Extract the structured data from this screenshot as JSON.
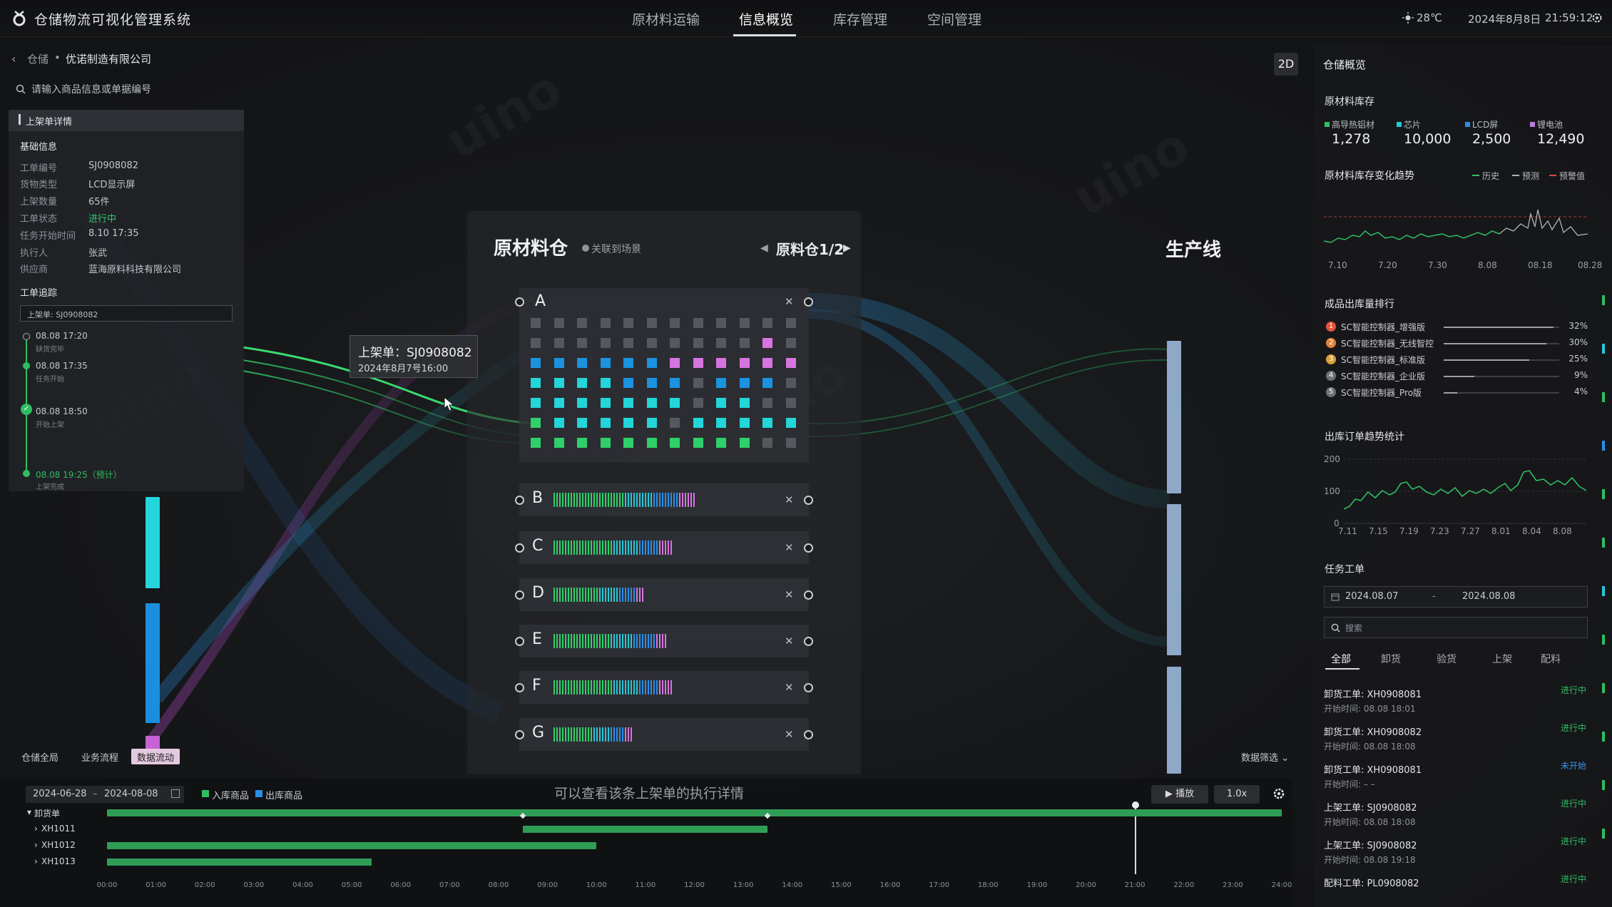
{
  "header": {
    "app_title": "仓储物流可视化管理系统",
    "tabs": [
      "原材料运输",
      "信息概览",
      "库存管理",
      "空间管理"
    ],
    "active_tab": "信息概览",
    "weather": "28℃",
    "date": "2024年8月8日",
    "time": "21:59:12"
  },
  "breadcrumb": {
    "parent": "仓储",
    "separator": "•",
    "current": "优诺制造有限公司"
  },
  "search": {
    "placeholder": "请输入商品信息或单据编号"
  },
  "detail": {
    "title": "上架单详情",
    "basic_title": "基础信息",
    "fields": [
      {
        "label": "工单编号",
        "value": "SJ0908082"
      },
      {
        "label": "货物类型",
        "value": "LCD显示屏"
      },
      {
        "label": "上架数量",
        "value": "65件"
      },
      {
        "label": "工单状态",
        "value": "进行中"
      },
      {
        "label": "任务开始时间",
        "value": "8.10 17:35"
      },
      {
        "label": "执行人",
        "value": "张武"
      },
      {
        "label": "供应商",
        "value": "蓝海原料科技有限公司"
      }
    ],
    "trace_title": "工单追踪",
    "trace_input": "上架单: SJ0908082",
    "trace": [
      {
        "time": "08.08 17:20",
        "note": "缺货完毕"
      },
      {
        "time": "08.08 17:35",
        "note": "任务开始"
      },
      {
        "time": "08.08 18:50",
        "note": "开始上架"
      },
      {
        "time": "08.08 19:25（预计）",
        "note": "上架完成"
      }
    ]
  },
  "bottom_tabs": [
    "仓储全局",
    "业务流程",
    "数据流动"
  ],
  "active_bottom_tab": "数据流动",
  "scene": {
    "warehouse_title": "原材料仓",
    "link_label": "关联到场景",
    "pager": "原料仓1/2",
    "production_title": "生产线",
    "rows": [
      "A",
      "B",
      "C",
      "D",
      "E",
      "F",
      "G"
    ],
    "row_fill": [
      1.0,
      0.55,
      0.47,
      0.36,
      0.44,
      0.47,
      0.31
    ],
    "tooltip_title": "上架单：SJ0908082",
    "tooltip_time": "2024年8月7号16:00",
    "view_toggle": "2D",
    "data_filter": "数据筛选"
  },
  "right": {
    "title": "仓储概览",
    "raw_title": "原材料库存",
    "raw_items": [
      {
        "name": "高导热铝材",
        "value": "1,278",
        "color": "#2fbf64"
      },
      {
        "name": "芯片",
        "value": "10,000",
        "color": "#28c7d6"
      },
      {
        "name": "LCD屏",
        "value": "2,500",
        "color": "#2a8ee6"
      },
      {
        "name": "锂电池",
        "value": "12,490",
        "color": "#b77ce0"
      }
    ],
    "trend_title": "原材料库存变化趋势",
    "trend_legend": [
      {
        "name": "历史",
        "color": "#2fbf64"
      },
      {
        "name": "预测",
        "color": "#b0b4ba"
      },
      {
        "name": "预警值",
        "color": "#e04848"
      }
    ],
    "trend_x": [
      "7.10",
      "7.20",
      "7.30",
      "8.08",
      "08.18",
      "08.28"
    ],
    "rank_title": "成品出库量排行",
    "rank": [
      {
        "n": "1",
        "name": "SC智能控制器_增强版",
        "pct": "32%",
        "p": 0.32,
        "color": "#e2533c"
      },
      {
        "n": "2",
        "name": "SC智能控制器_无线智控",
        "pct": "30%",
        "p": 0.3,
        "color": "#e2833c"
      },
      {
        "n": "3",
        "name": "SC智能控制器_标准版",
        "pct": "25%",
        "p": 0.25,
        "color": "#d9a23a"
      },
      {
        "n": "4",
        "name": "SC智能控制器_企业版",
        "pct": "9%",
        "p": 0.09,
        "color": "#6d7178"
      },
      {
        "n": "5",
        "name": "SC智能控制器_Pro版",
        "pct": "4%",
        "p": 0.04,
        "color": "#6d7178"
      }
    ],
    "orders_title": "出库订单趋势统计",
    "orders_y": [
      "200",
      "100",
      "0"
    ],
    "orders_x": [
      "7.11",
      "7.15",
      "7.19",
      "7.23",
      "7.27",
      "8.01",
      "8.04",
      "8.08"
    ],
    "tasks_title": "任务工单",
    "date_from": "2024.08.07",
    "date_sep": "-",
    "date_to": "2024.08.08",
    "task_search_ph": "搜索",
    "task_tabs": [
      "全部",
      "卸货",
      "验货",
      "上架",
      "配料"
    ],
    "active_task_tab": "全部",
    "work_orders": [
      {
        "title": "卸货工单: XH0908081",
        "sub": "开始时间: 08.08 18:01",
        "status": "进行中",
        "kind": "green"
      },
      {
        "title": "卸货工单: XH0908082",
        "sub": "开始时间: 08.08 18:08",
        "status": "进行中",
        "kind": "green"
      },
      {
        "title": "卸货工单: XH0908081",
        "sub": "开始时间: – –",
        "status": "未开始",
        "kind": "blue"
      },
      {
        "title": "上架工单: SJ0908082",
        "sub": "开始时间: 08.08 18:08",
        "status": "进行中",
        "kind": "green"
      },
      {
        "title": "上架工单: SJ0908082",
        "sub": "开始时间: 08.08 19:18",
        "status": "进行中",
        "kind": "green"
      },
      {
        "title": "配料工单: PL0908082",
        "sub": "",
        "status": "进行中",
        "kind": "green"
      }
    ]
  },
  "timeline": {
    "date_from": "2024-06-28",
    "date_sep": "–",
    "date_to": "2024-08-08",
    "legend_in": "入库商品",
    "legend_out": "出库商品",
    "hint": "可以查看该条上架单的执行详情",
    "play_label": "播放",
    "speed": "1.0x",
    "rows": [
      {
        "label": "卸货单",
        "start_h": 0.0,
        "end_h": 24.0
      },
      {
        "label": "XH1011",
        "start_h": 8.5,
        "end_h": 13.5
      },
      {
        "label": "XH1012",
        "start_h": 0.0,
        "end_h": 10.0
      },
      {
        "label": "XH1013",
        "start_h": 0.0,
        "end_h": 5.4
      }
    ],
    "ticks": [
      "00:00",
      "01:00",
      "02:00",
      "03:00",
      "04:00",
      "05:00",
      "06:00",
      "07:00",
      "08:00",
      "09:00",
      "10:00",
      "11:00",
      "12:00",
      "13:00",
      "14:00",
      "15:00",
      "16:00",
      "17:00",
      "18:00",
      "19:00",
      "20:00",
      "21:00",
      "22:00",
      "23:00",
      "24:00"
    ],
    "playhead_h": 21.0
  }
}
